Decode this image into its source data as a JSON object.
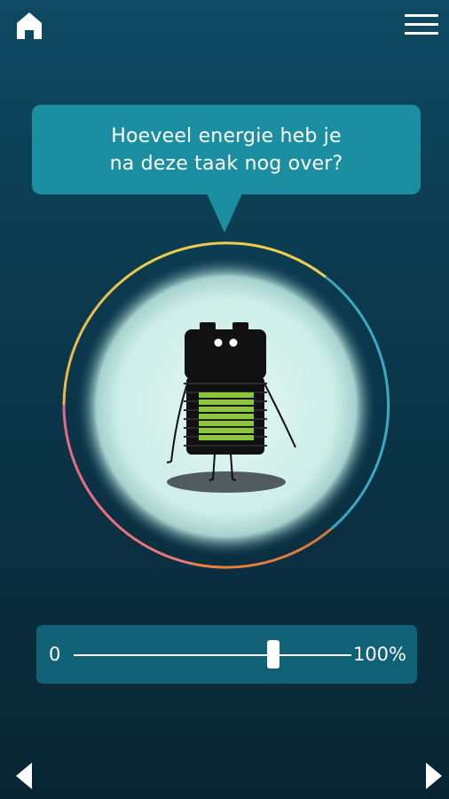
{
  "header": {
    "home_icon": "home-icon",
    "menu_icon": "hamburger-menu-icon"
  },
  "question": {
    "text": "Hoeveel energie heb je\nna deze taak nog over?"
  },
  "illustration": {
    "subject": "battery-character",
    "ring_colors": [
      "#e9c24a",
      "#3fb0c8",
      "#e8873c",
      "#e36f8a"
    ],
    "battery_fill_color": "#8cc63f"
  },
  "slider": {
    "min_label": "0",
    "max_label": "100%",
    "value_fraction": 0.72
  },
  "navigation": {
    "prev_icon": "arrow-left-icon",
    "next_icon": "arrow-right-icon"
  },
  "colors": {
    "background": "#0b3a4f",
    "bubble": "#1b8fa1",
    "slider_panel": "#116277"
  }
}
